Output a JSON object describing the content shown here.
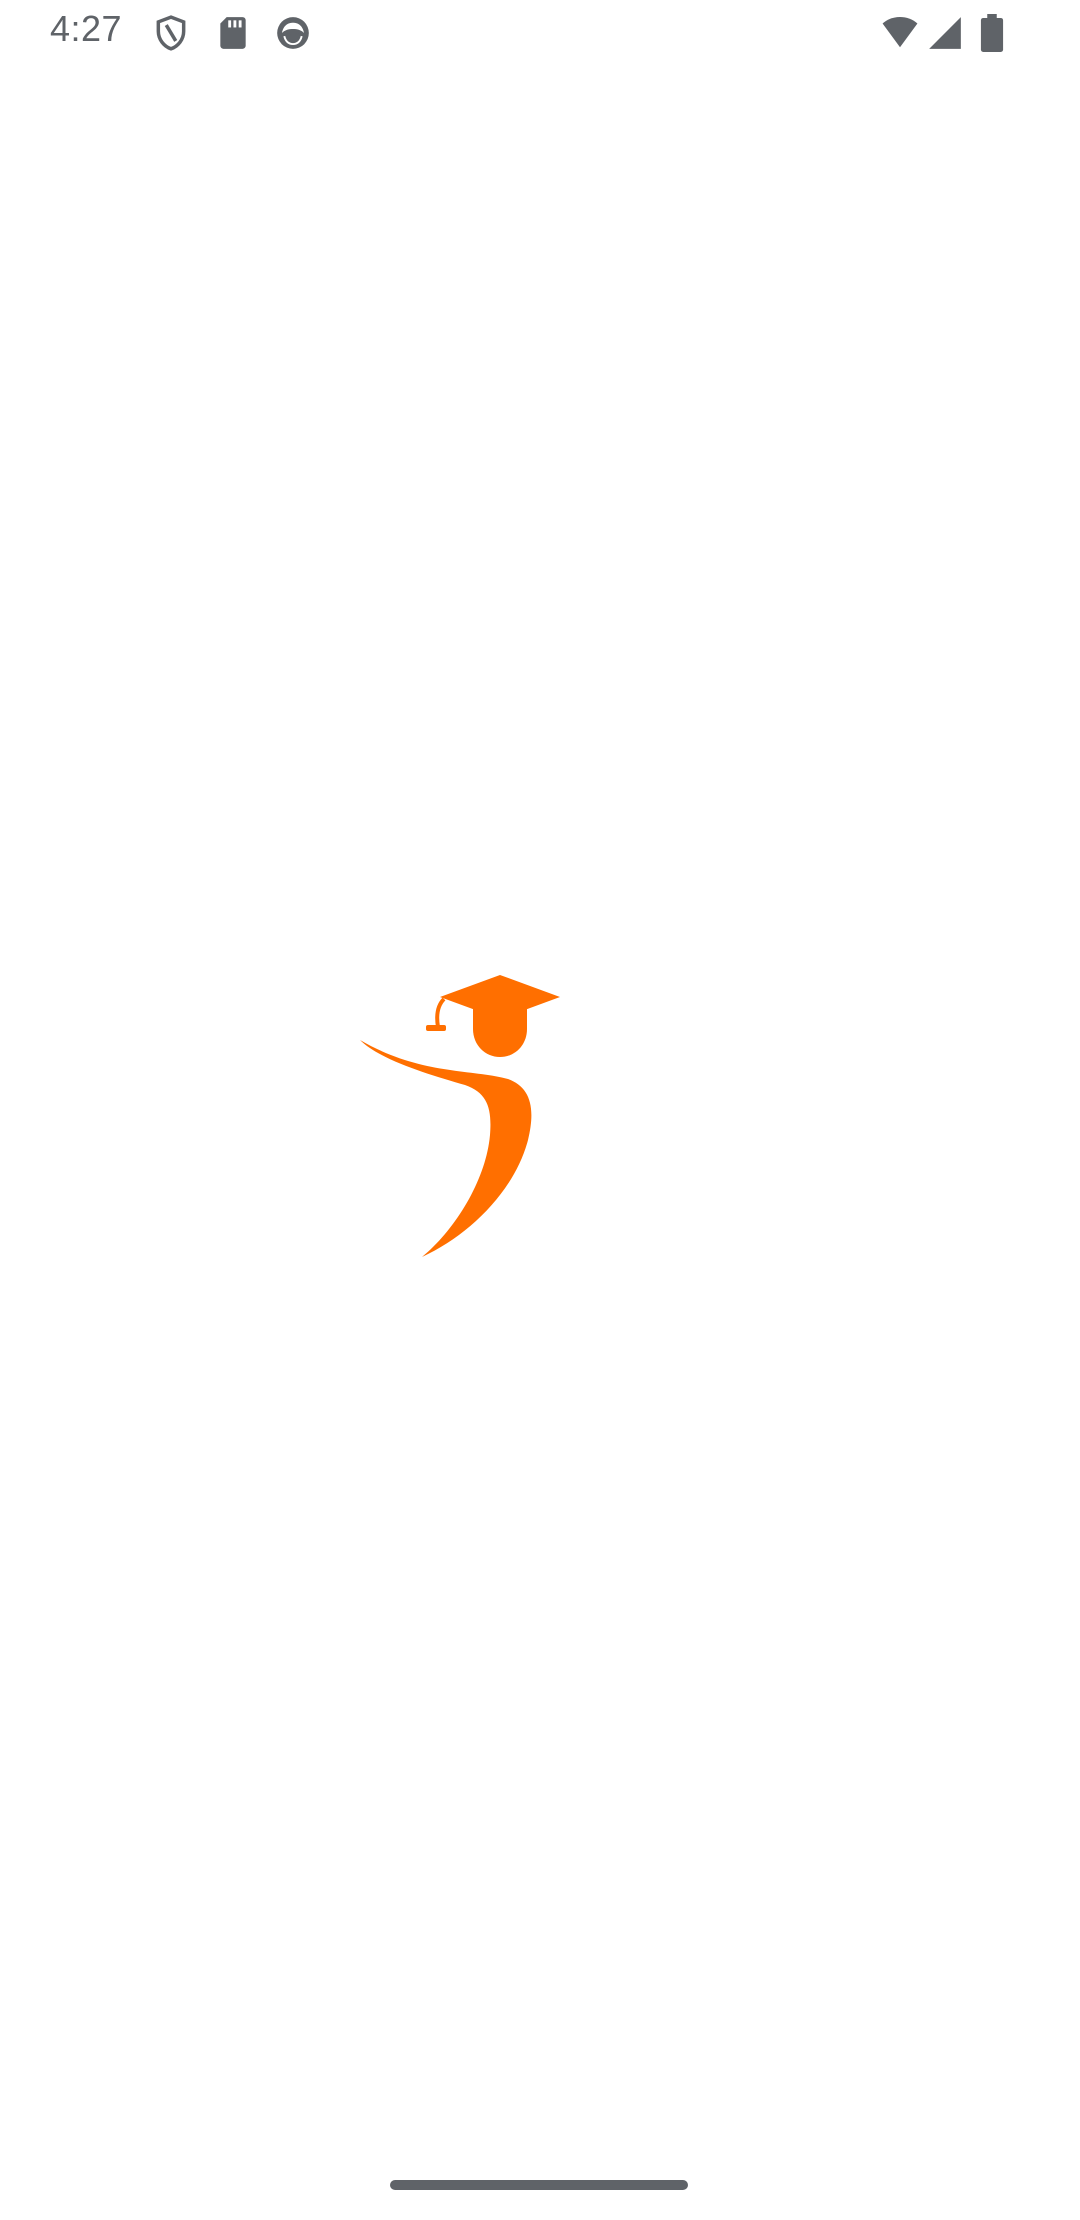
{
  "status_bar": {
    "time": "4:27",
    "icons": [
      "shield-icon",
      "sd-card-icon",
      "face-icon",
      "wifi-icon",
      "cell-signal-icon",
      "battery-icon"
    ],
    "icon_color": "#5f6368"
  },
  "splash": {
    "logo": "graduate-figure-logo",
    "logo_color": "#ff6f00"
  },
  "navigation": {
    "gesture_handle": "nav-handle",
    "handle_color": "#5f6368"
  }
}
